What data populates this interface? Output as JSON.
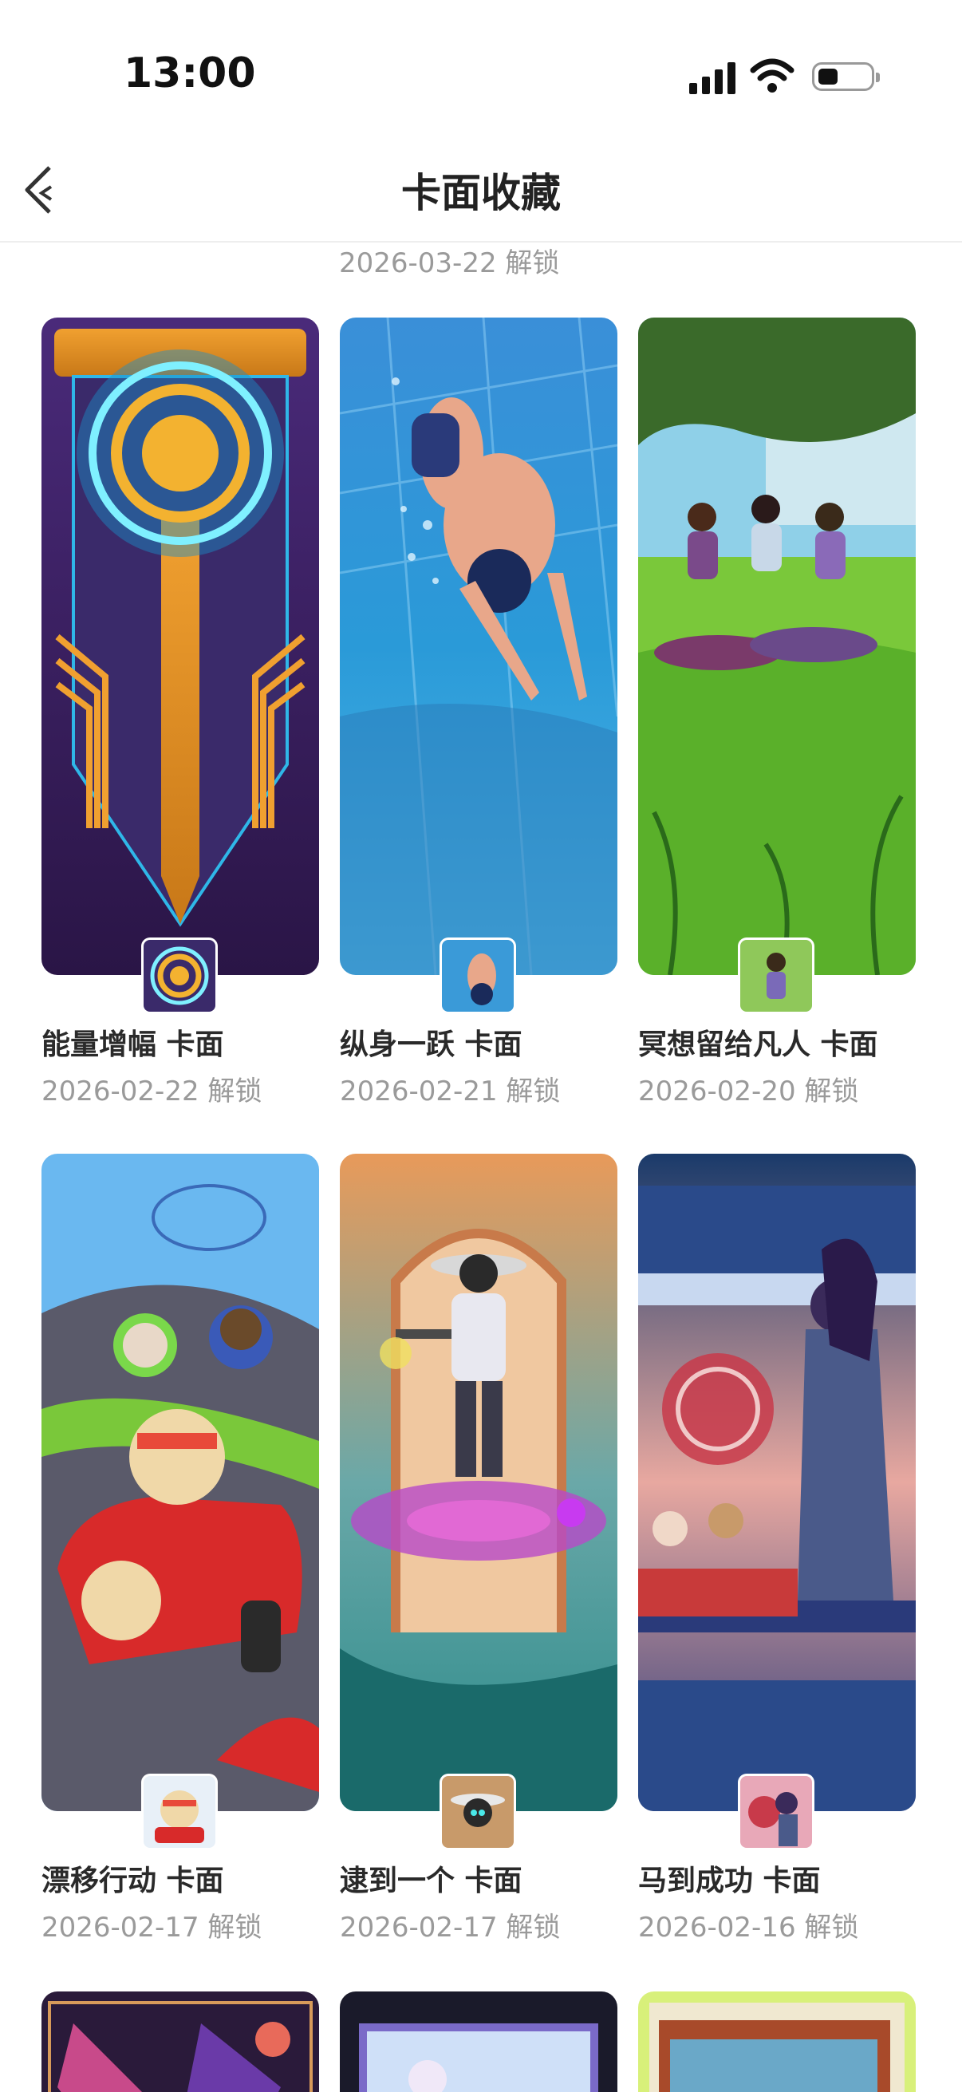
{
  "status_bar": {
    "time": "13:00"
  },
  "header": {
    "title": "卡面收藏"
  },
  "top_cut_date": "2026-03-22 解锁",
  "cards": [
    {
      "name": "能量增幅 卡面",
      "date": "2026-02-22 解锁",
      "icon": "energy-ring-icon"
    },
    {
      "name": "纵身一跃 卡面",
      "date": "2026-02-21 解锁",
      "icon": "diver-icon"
    },
    {
      "name": "冥想留给凡人 卡面",
      "date": "2026-02-20 解锁",
      "icon": "meditation-icon"
    },
    {
      "name": "漂移行动 卡面",
      "date": "2026-02-17 解锁",
      "icon": "kart-bear-icon"
    },
    {
      "name": "逮到一个 卡面",
      "date": "2026-02-17 解锁",
      "icon": "cowboy-icon"
    },
    {
      "name": "马到成功 卡面",
      "date": "2026-02-16 解锁",
      "icon": "horse-fortune-icon"
    }
  ],
  "colors": {
    "text": "#2a2a2a",
    "subtext": "#9a9a9a",
    "divider": "#eeeeee"
  }
}
